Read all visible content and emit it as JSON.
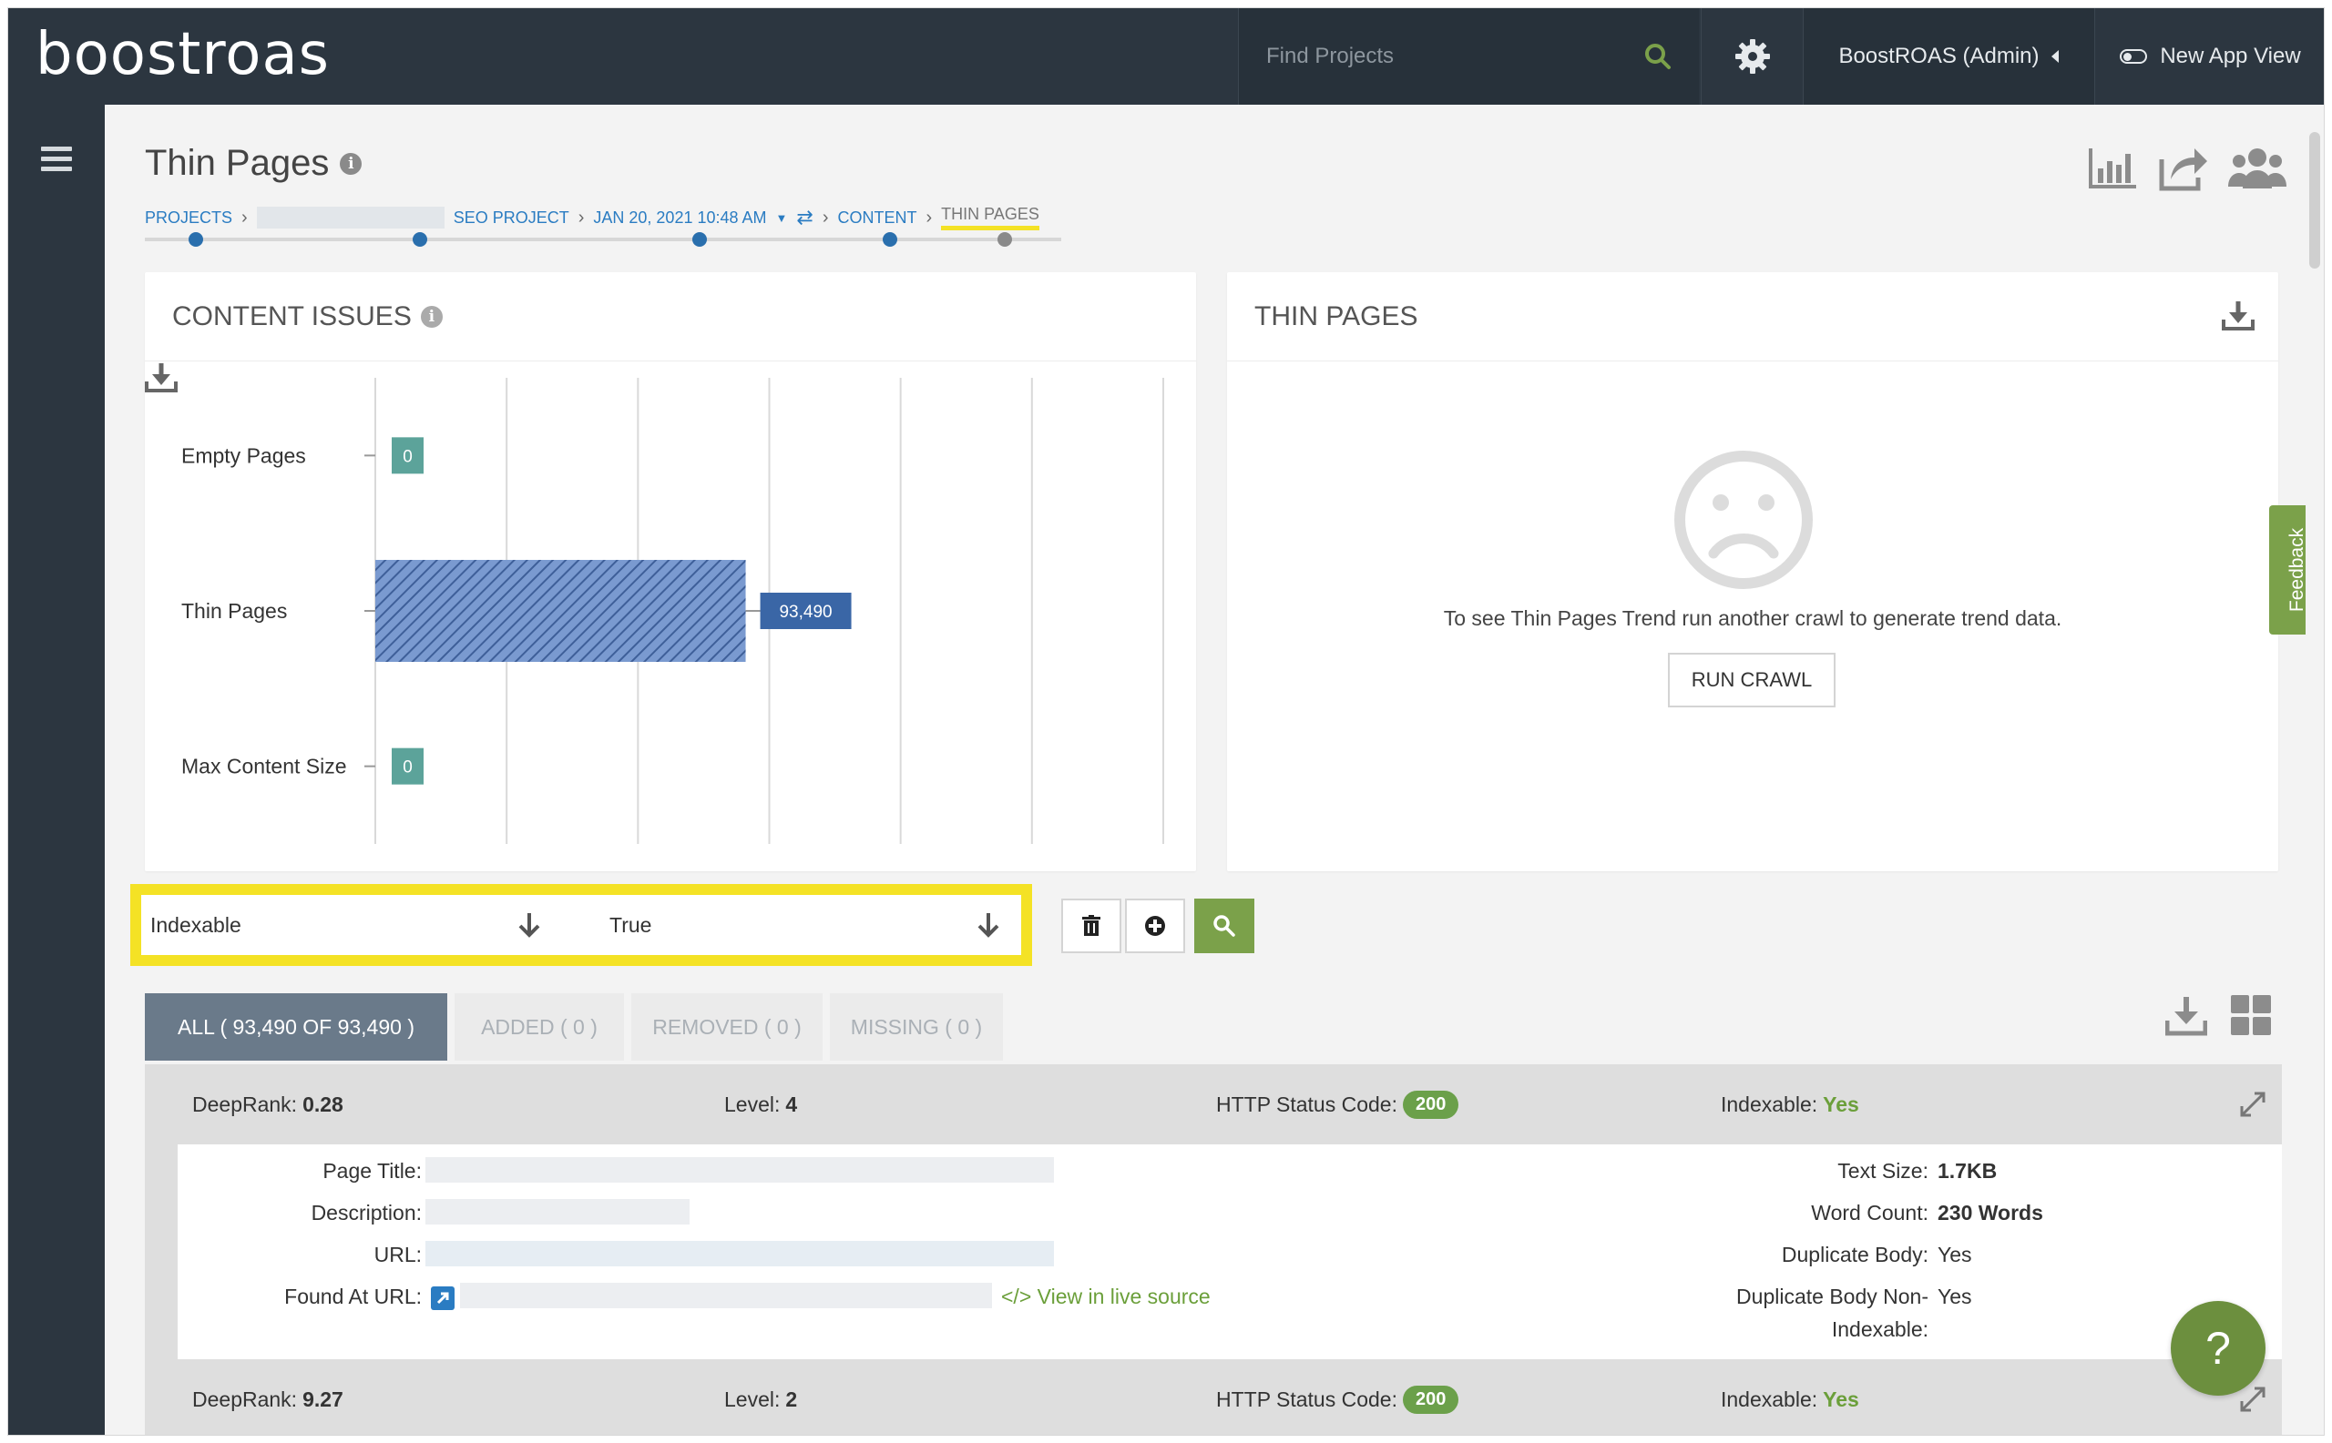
{
  "topbar": {
    "logo_text": "boostroas",
    "search_placeholder": "Find Projects",
    "user_label": "BoostROAS (Admin)",
    "new_view_label": "New App View"
  },
  "page": {
    "title": "Thin Pages",
    "breadcrumbs": [
      "PROJECTS",
      "SEO PROJECT",
      "JAN 20, 2021 10:48 AM",
      "CONTENT",
      "THIN PAGES"
    ]
  },
  "content_issues": {
    "title": "CONTENT ISSUES"
  },
  "chart_data": {
    "type": "bar",
    "orientation": "horizontal",
    "categories": [
      "Empty Pages",
      "Thin Pages",
      "Max Content Size"
    ],
    "values": [
      0,
      93490,
      0
    ],
    "value_labels": [
      "0",
      "93,490",
      "0"
    ],
    "colors": {
      "bar": "#7a9ad0",
      "label_zero": "#5ca39a",
      "label_main": "#3a66a6"
    },
    "grid": true
  },
  "thin_pages_panel": {
    "title": "THIN PAGES",
    "message": "To see Thin Pages Trend run another crawl to generate trend data.",
    "button": "RUN CRAWL"
  },
  "filter": {
    "field": "Indexable",
    "value": "True"
  },
  "tabs": [
    {
      "label": "ALL ( 93,490 OF 93,490 )"
    },
    {
      "label": "ADDED ( 0 )"
    },
    {
      "label": "REMOVED ( 0 )"
    },
    {
      "label": "MISSING ( 0 )"
    }
  ],
  "rows": [
    {
      "deeprank_label": "DeepRank:",
      "deeprank": "0.28",
      "level_label": "Level:",
      "level": "4",
      "http_label": "HTTP Status Code:",
      "http": "200",
      "indexable_label": "Indexable:",
      "indexable": "Yes"
    },
    {
      "deeprank_label": "DeepRank:",
      "deeprank": "9.27",
      "level_label": "Level:",
      "level": "2",
      "http_label": "HTTP Status Code:",
      "http": "200",
      "indexable_label": "Indexable:",
      "indexable": "Yes"
    }
  ],
  "detail": {
    "page_title_label": "Page Title:",
    "description_label": "Description:",
    "url_label": "URL:",
    "found_at_label": "Found At URL:",
    "live_source": "View in live source",
    "text_size_label": "Text Size:",
    "text_size": "1.7KB",
    "word_count_label": "Word Count:",
    "word_count": "230 Words",
    "dup_body_label": "Duplicate Body:",
    "dup_body": "Yes",
    "dup_nonidx_label_1": "Duplicate Body Non-",
    "dup_nonidx_label_2": "Indexable:",
    "dup_nonidx": "Yes"
  },
  "feedback_label": "Feedback",
  "help_label": "?"
}
